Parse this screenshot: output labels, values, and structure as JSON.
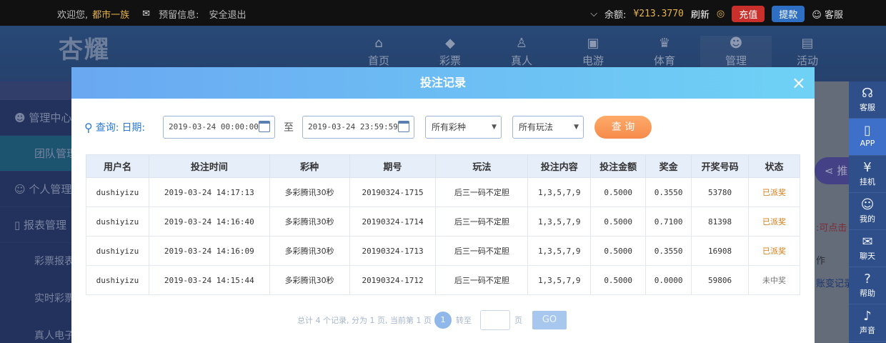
{
  "topbar": {
    "welcome": "欢迎您,",
    "username": "都市一族",
    "reserved_info": "预留信息:",
    "logout": "安全退出",
    "balance_label": "余额:",
    "balance_value": "¥213.3770",
    "refresh": "刷新",
    "recharge": "充值",
    "withdraw": "提款",
    "customer_service": "客服"
  },
  "header": {
    "logo": "杏耀",
    "nav": [
      {
        "label": "首页",
        "icon": "home-icon"
      },
      {
        "label": "彩票",
        "icon": "diamond-icon"
      },
      {
        "label": "真人",
        "icon": "person-icon"
      },
      {
        "label": "电游",
        "icon": "game-icon"
      },
      {
        "label": "体育",
        "icon": "trophy-icon"
      },
      {
        "label": "管理",
        "icon": "users-icon"
      },
      {
        "label": "活动",
        "icon": "gift-icon"
      }
    ]
  },
  "sidebar": {
    "items": [
      {
        "label": "管理中心"
      },
      {
        "label": "团队管理"
      },
      {
        "label": "个人管理"
      },
      {
        "label": "报表管理"
      },
      {
        "label": "彩票报表"
      },
      {
        "label": "实时彩票"
      },
      {
        "label": "真人电子"
      }
    ]
  },
  "right_bg": {
    "pill": "推",
    "hint": ":可点击",
    "col": "作",
    "link": "账变记录"
  },
  "floatbar": {
    "items": [
      {
        "label": "客服",
        "icon": "headset-icon"
      },
      {
        "label": "APP",
        "icon": "phone-icon"
      },
      {
        "label": "挂机",
        "icon": "robot-icon"
      },
      {
        "label": "我的",
        "icon": "user-icon"
      },
      {
        "label": "聊天",
        "icon": "chat-icon"
      },
      {
        "label": "帮助",
        "icon": "help-icon"
      },
      {
        "label": "声音",
        "icon": "sound-icon"
      }
    ]
  },
  "modal": {
    "title": "投注记录",
    "close": "×",
    "query_label": "查询:",
    "date_label": "日期:",
    "start_date": "2019-03-24 00:00:00",
    "to": "至",
    "end_date": "2019-03-24 23:59:59",
    "lottery_select": "所有彩种",
    "play_select": "所有玩法",
    "query_button": "查 询",
    "columns": [
      "用户名",
      "投注时间",
      "彩种",
      "期号",
      "玩法",
      "投注内容",
      "投注金额",
      "奖金",
      "开奖号码",
      "状态"
    ],
    "rows": [
      [
        "dushiyizu",
        "2019-03-24 14:17:13",
        "多彩腾讯30秒",
        "20190324-1715",
        "后三一码不定胆",
        "1,3,5,7,9",
        "0.5000",
        "0.3550",
        "53780",
        "已派奖"
      ],
      [
        "dushiyizu",
        "2019-03-24 14:16:40",
        "多彩腾讯30秒",
        "20190324-1714",
        "后三一码不定胆",
        "1,3,5,7,9",
        "0.5000",
        "0.7100",
        "81398",
        "已派奖"
      ],
      [
        "dushiyizu",
        "2019-03-24 14:16:09",
        "多彩腾讯30秒",
        "20190324-1713",
        "后三一码不定胆",
        "1,3,5,7,9",
        "0.5000",
        "0.3550",
        "16908",
        "已派奖"
      ],
      [
        "dushiyizu",
        "2019-03-24 14:15:44",
        "多彩腾讯30秒",
        "20190324-1712",
        "后三一码不定胆",
        "1,3,5,7,9",
        "0.5000",
        "0.0000",
        "59806",
        "未中奖"
      ]
    ],
    "pager": {
      "summary": "总计 4 个记录, 分为 1 页, 当前第 1 页",
      "current": "1",
      "jump_label": "转至",
      "page_unit": "页",
      "go": "GO"
    }
  },
  "colors": {
    "accent": "#2a7ad4",
    "paid": "#d97a12",
    "query_button": "#f58a4a"
  }
}
